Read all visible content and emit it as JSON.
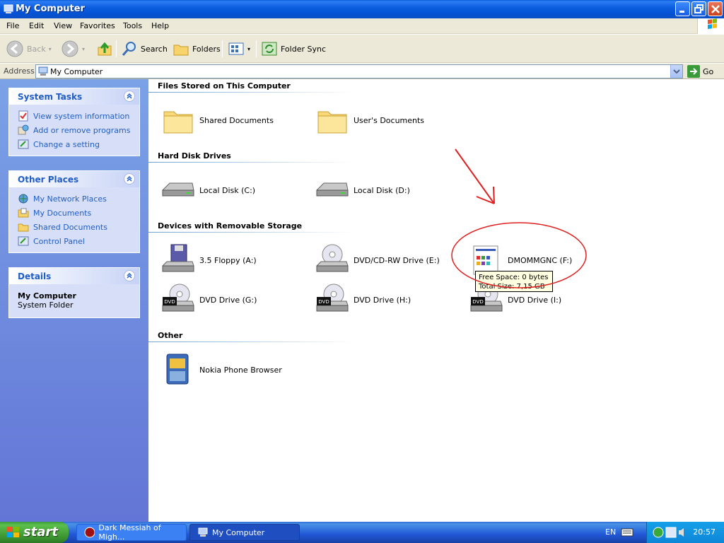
{
  "window": {
    "title": "My Computer"
  },
  "menu": [
    "File",
    "Edit",
    "View",
    "Favorites",
    "Tools",
    "Help"
  ],
  "toolbar": {
    "back": "Back",
    "search": "Search",
    "folders": "Folders",
    "folder_sync": "Folder Sync"
  },
  "address": {
    "label": "Address",
    "value": "My Computer",
    "go": "Go"
  },
  "system_tasks": {
    "title": "System Tasks",
    "items": [
      "View system information",
      "Add or remove programs",
      "Change a setting"
    ]
  },
  "other_places": {
    "title": "Other Places",
    "items": [
      "My Network Places",
      "My Documents",
      "Shared Documents",
      "Control Panel"
    ]
  },
  "details": {
    "title": "Details",
    "name": "My Computer",
    "type": "System Folder"
  },
  "groups": {
    "files": {
      "title": "Files Stored on This Computer",
      "items": [
        "Shared Documents",
        "User's Documents"
      ]
    },
    "hdd": {
      "title": "Hard Disk Drives",
      "items": [
        "Local Disk (C:)",
        "Local Disk (D:)"
      ]
    },
    "removable": {
      "title": "Devices with Removable Storage",
      "items": [
        "3.5 Floppy (A:)",
        "DVD/CD-RW Drive (E:)",
        "DMOMMGNC (F:)",
        "DVD Drive (G:)",
        "DVD Drive (H:)",
        "DVD Drive (I:)"
      ]
    },
    "other": {
      "title": "Other",
      "items": [
        "Nokia Phone Browser"
      ]
    }
  },
  "tooltip": {
    "line1": "Free Space: 0 bytes",
    "line2": "Total Size: 7,15 GB"
  },
  "taskbar": {
    "start": "start",
    "tasks": [
      "Dark Messiah of Migh...",
      "My Computer"
    ],
    "language": "EN",
    "clock": "20:57"
  },
  "colors": {
    "annotation": "#e02020",
    "link": "#215dc6"
  }
}
